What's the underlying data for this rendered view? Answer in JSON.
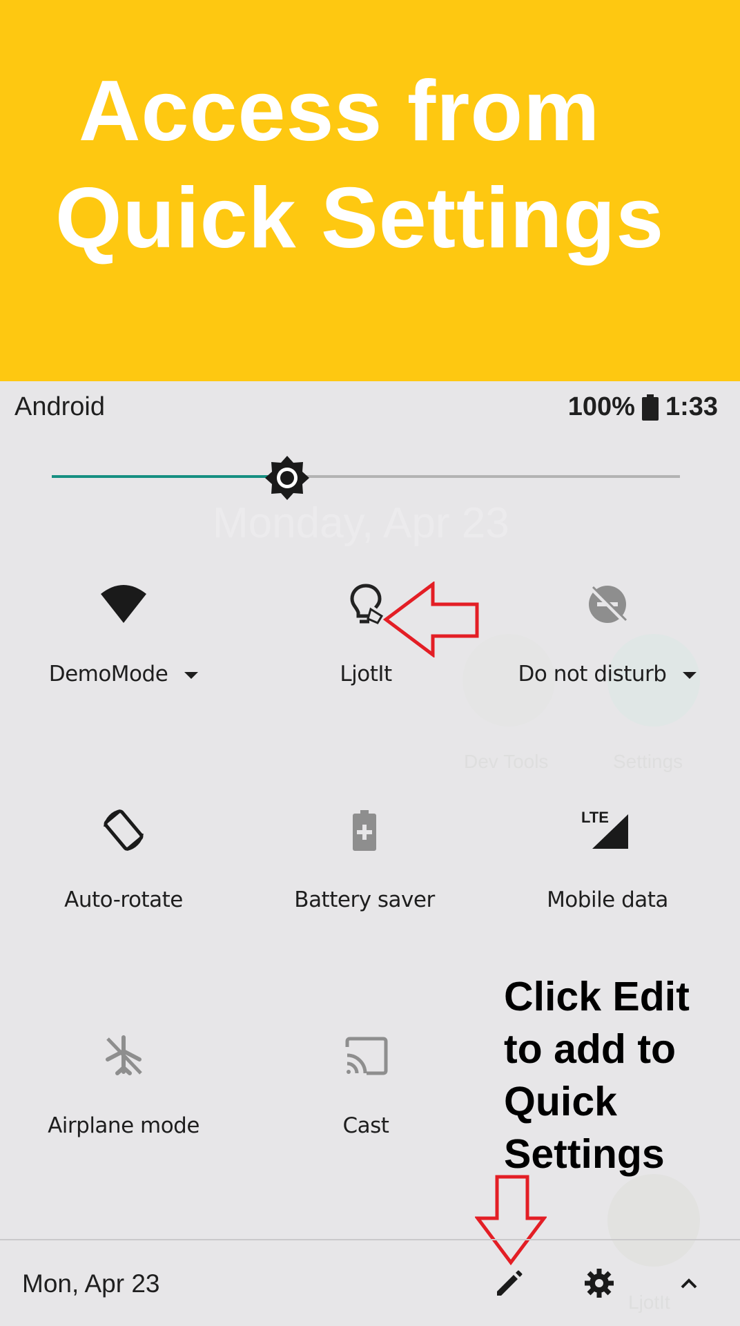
{
  "banner": {
    "line1": "Access from",
    "line2": "Quick Settings",
    "color": "#fec811"
  },
  "status_bar": {
    "carrier": "Android",
    "battery": "100%",
    "time": "1:33"
  },
  "brightness": {
    "level": 0.37,
    "accent": "#168f81"
  },
  "background_ghost": {
    "date": "Monday, Apr 23",
    "apps": [
      "Dev Tools",
      "Settings",
      "LjotIt"
    ]
  },
  "tiles": [
    {
      "label": "DemoMode",
      "icon": "wifi-icon",
      "dropdown": true
    },
    {
      "label": "LjotIt",
      "icon": "ljotit-bulb-icon"
    },
    {
      "label": "Do not disturb",
      "icon": "do-not-disturb-icon",
      "dropdown": true
    },
    {
      "label": "Auto-rotate",
      "icon": "auto-rotate-icon"
    },
    {
      "label": "Battery saver",
      "icon": "battery-saver-icon"
    },
    {
      "label": "Mobile data",
      "icon": "lte-signal-icon",
      "badge": "LTE"
    },
    {
      "label": "Airplane mode",
      "icon": "airplane-off-icon"
    },
    {
      "label": "Cast",
      "icon": "cast-icon"
    }
  ],
  "annotation": {
    "lines": [
      "Click Edit",
      "to add to",
      "Quick",
      "Settings"
    ]
  },
  "footer": {
    "date": "Mon, Apr 23",
    "icons": [
      "edit-pencil-icon",
      "gear-icon",
      "chevron-up-icon"
    ]
  },
  "arrow_color": "#e31e25"
}
